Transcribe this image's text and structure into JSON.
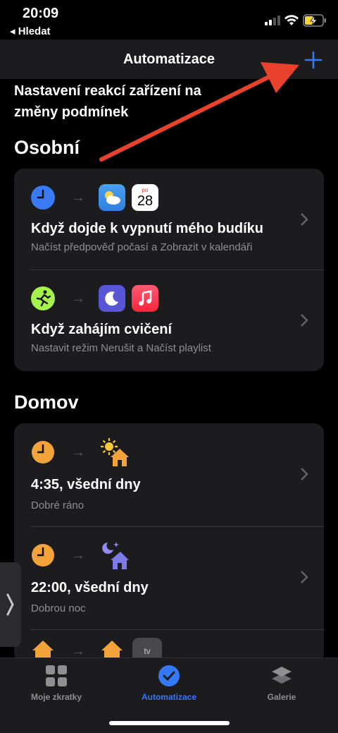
{
  "status_bar": {
    "time": "20:09",
    "back_label": "Hledat"
  },
  "nav": {
    "title": "Automatizace",
    "add_icon": "plus-icon"
  },
  "subtitle": "Nastavení reakcí zařízení na změny podmínek",
  "sections": {
    "personal": {
      "title": "Osobní",
      "items": [
        {
          "title": "Když dojde k vypnutí mého budíku",
          "subtitle": "Načíst předpověď počasí a Zobrazit v kalendáři",
          "calendar_day": "28",
          "calendar_weekday": "po"
        },
        {
          "title": "Když zahájím cvičení",
          "subtitle": "Nastavit režim Nerušit a Načíst playlist"
        }
      ]
    },
    "home": {
      "title": "Domov",
      "items": [
        {
          "title": "4:35, všední dny",
          "subtitle": "Dobré ráno"
        },
        {
          "title": "22:00, všední dny",
          "subtitle": "Dobrou noc"
        }
      ],
      "partial_tile_label": "tv"
    }
  },
  "tabbar": {
    "tabs": [
      {
        "label": "Moje zkratky",
        "icon": "grid-icon"
      },
      {
        "label": "Automatizace",
        "icon": "clock-icon",
        "active": true
      },
      {
        "label": "Galerie",
        "icon": "layers-icon"
      }
    ]
  },
  "colors": {
    "accent": "#3478f6",
    "annotation_arrow": "#e8412c",
    "orange": "#f2a33a",
    "card": "#1c1c1e"
  }
}
